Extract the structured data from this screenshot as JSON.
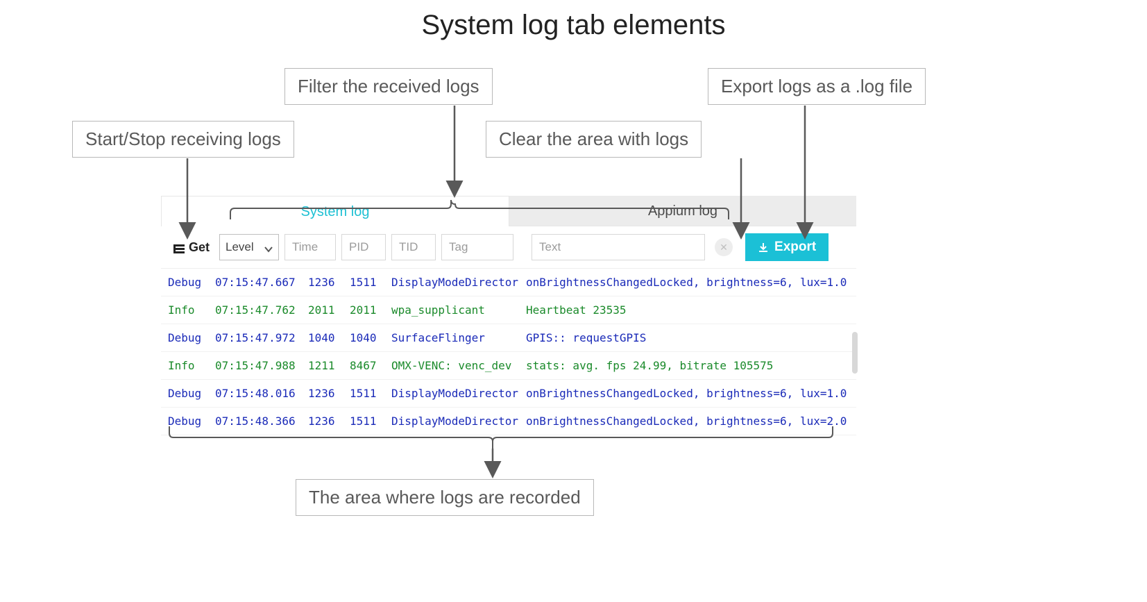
{
  "title": "System log tab elements",
  "callouts": {
    "start_stop": "Start/Stop receiving logs",
    "filter": "Filter the received logs",
    "clear": "Clear the area with logs",
    "export": "Export logs as a .log file",
    "area": "The area where logs are recorded"
  },
  "tabs": {
    "active": "System log",
    "inactive": "Appium log"
  },
  "toolbar": {
    "get_label": "Get",
    "level_label": "Level",
    "placeholders": {
      "time": "Time",
      "pid": "PID",
      "tid": "TID",
      "tag": "Tag",
      "text": "Text"
    },
    "export_label": "Export"
  },
  "logs": [
    {
      "level": "Debug",
      "time": "07:15:47.667",
      "pid": "1236",
      "tid": "1511",
      "tag": "DisplayModeDirector",
      "msg": "onBrightnessChangedLocked, brightness=6, lux=1.0",
      "cls": "lvl-debug"
    },
    {
      "level": "Info",
      "time": "07:15:47.762",
      "pid": "2011",
      "tid": "2011",
      "tag": "wpa_supplicant",
      "msg": "Heartbeat 23535",
      "cls": "lvl-info"
    },
    {
      "level": "Debug",
      "time": "07:15:47.972",
      "pid": "1040",
      "tid": "1040",
      "tag": "SurfaceFlinger",
      "msg": "GPIS:: requestGPIS",
      "cls": "lvl-debug"
    },
    {
      "level": "Info",
      "time": "07:15:47.988",
      "pid": "1211",
      "tid": "8467",
      "tag": "OMX-VENC: venc_dev",
      "msg": "stats: avg. fps 24.99, bitrate 105575",
      "cls": "lvl-info"
    },
    {
      "level": "Debug",
      "time": "07:15:48.016",
      "pid": "1236",
      "tid": "1511",
      "tag": "DisplayModeDirector",
      "msg": "onBrightnessChangedLocked, brightness=6, lux=1.0",
      "cls": "lvl-debug"
    },
    {
      "level": "Debug",
      "time": "07:15:48.366",
      "pid": "1236",
      "tid": "1511",
      "tag": "DisplayModeDirector",
      "msg": "onBrightnessChangedLocked, brightness=6, lux=2.0",
      "cls": "lvl-debug"
    }
  ]
}
